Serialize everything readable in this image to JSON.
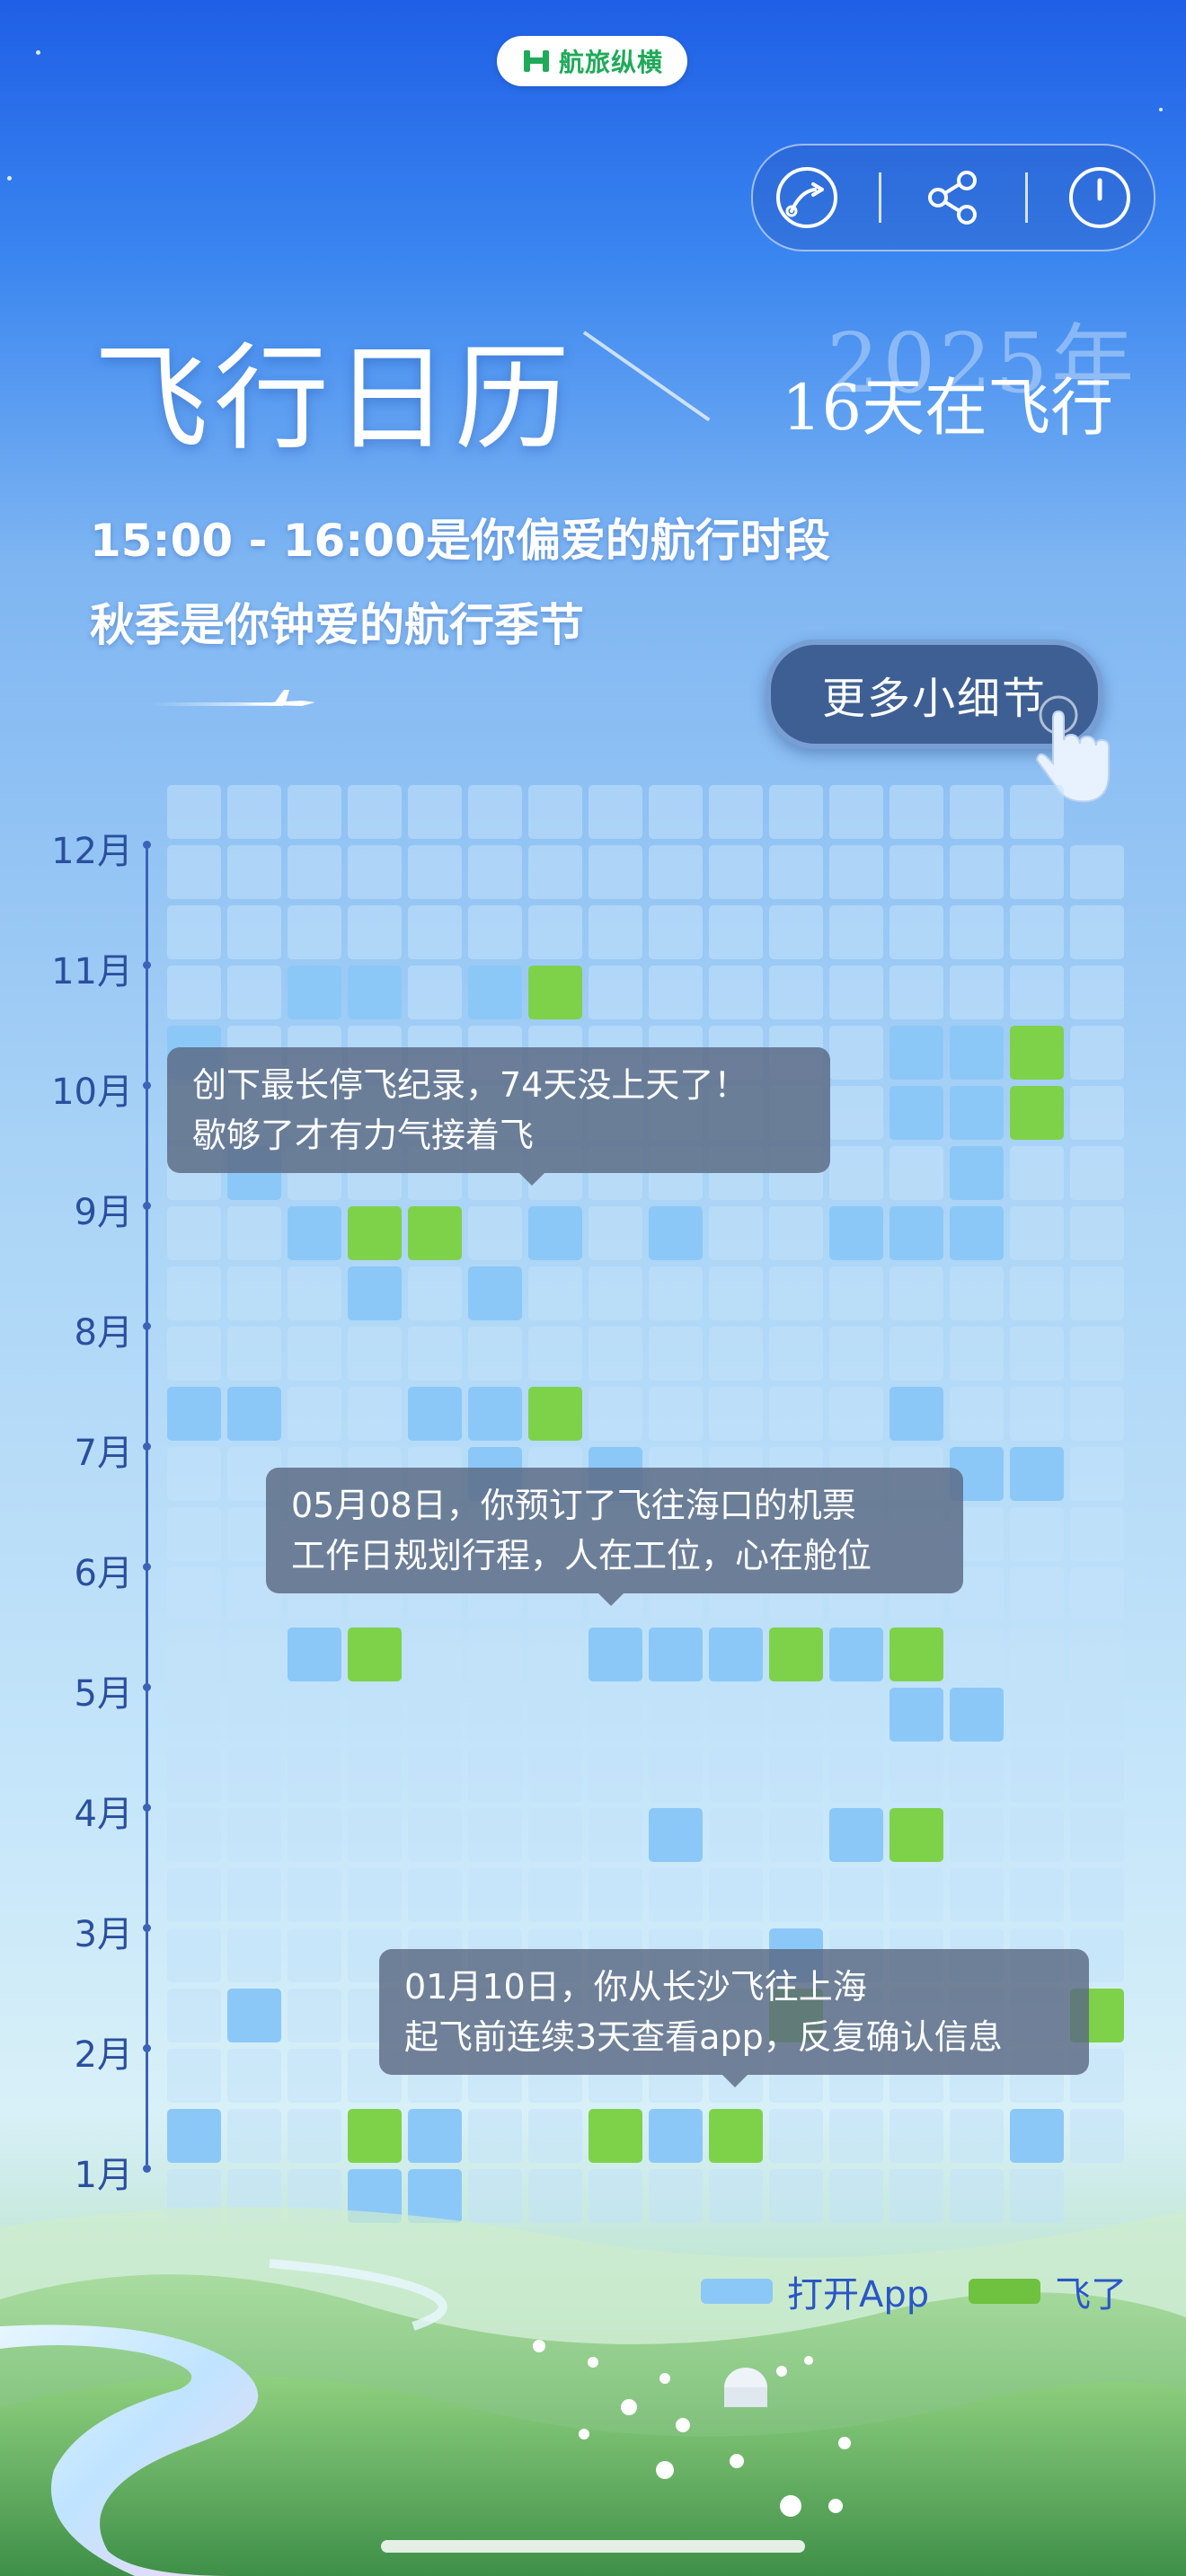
{
  "brand": {
    "name": "航旅纵横",
    "logo_icon": "umetrip-logo-icon",
    "color": "#1faa59"
  },
  "toolbar": {
    "buttons": [
      {
        "name": "replay-button",
        "icon": "play-curve-icon"
      },
      {
        "name": "share-button",
        "icon": "share-icon"
      },
      {
        "name": "power-button",
        "icon": "power-icon"
      }
    ]
  },
  "header": {
    "title": "飞行日历",
    "year": "2025年",
    "days_flying": "16天在飞行",
    "line1": "15:00 - 16:00是你偏爱的航行时段",
    "line2": "秋季是你钟爱的航行季节",
    "more_button": "更多小细节"
  },
  "calendar": {
    "months": [
      "12月",
      "11月",
      "10月",
      "9月",
      "8月",
      "7月",
      "6月",
      "5月",
      "4月",
      "3月",
      "2月",
      "1月"
    ],
    "colors": {
      "open": "#8cc8f7",
      "fly": "#7ed24a",
      "empty": "#c3e1fa"
    },
    "legend": {
      "open": "打开App",
      "fly": "飞了"
    }
  },
  "tooltips": {
    "t1": {
      "line1": "创下最长停飞纪录，74天没上天了！",
      "line2": "歇够了才有力气接着飞"
    },
    "t2": {
      "line1": "05月08日，你预订了飞往海口的机票",
      "line2": "工作日规划行程，人在工位，心在舱位"
    },
    "t3": {
      "line1": "01月10日，你从长沙飞往上海",
      "line2": "起飞前连续3天查看app，反复确认信息"
    }
  }
}
